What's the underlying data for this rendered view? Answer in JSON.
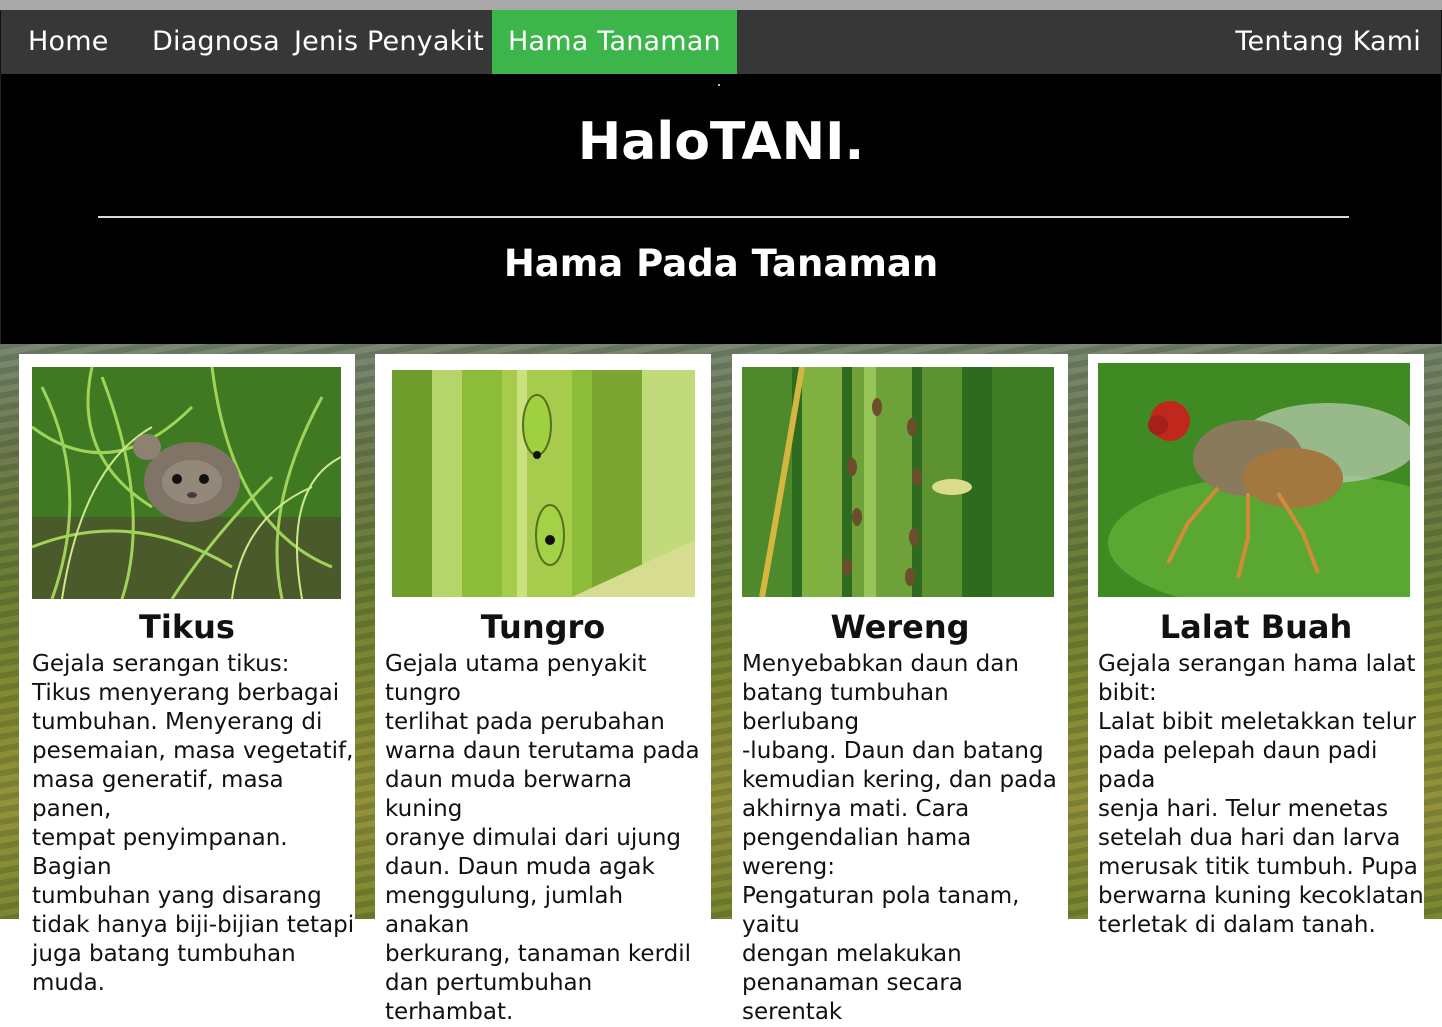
{
  "nav": {
    "items": [
      "Home",
      "Diagnosa",
      "Jenis Penyakit",
      "Hama Tanaman"
    ],
    "active": "Hama Tanaman",
    "right": "Tentang Kami"
  },
  "hero": {
    "title": "HaloTANI.",
    "subtitle": "Hama Pada Tanaman"
  },
  "cards": [
    {
      "title": "Tikus",
      "image_icon": "mouse-in-grass-photo",
      "text": "Gejala serangan tikus:\nTikus menyerang berbagai\ntumbuhan. Menyerang di\npesemaian, masa vegetatif,\nmasa generatif, masa panen,\ntempat penyimpanan. Bagian\ntumbuhan yang disarang\ntidak hanya biji-bijian tetapi\njuga batang tumbuhan muda."
    },
    {
      "title": "Tungro",
      "image_icon": "leafhopper-on-stem-photo",
      "text": "Gejala utama penyakit tungro\nterlihat pada perubahan\nwarna daun terutama pada\ndaun muda berwarna kuning\noranye dimulai dari ujung\ndaun. Daun muda agak\nmenggulung, jumlah anakan\nberkurang, tanaman kerdil\ndan pertumbuhan terhambat."
    },
    {
      "title": "Wereng",
      "image_icon": "planthopper-on-stem-photo",
      "text": "Menyebabkan daun dan\nbatang tumbuhan berlubang\n-lubang. Daun dan batang\nkemudian kering, dan pada\nakhirnya mati. Cara\npengendalian hama wereng:\nPengaturan pola tanam, yaitu\ndengan melakukan\npenanaman secara serentak"
    },
    {
      "title": "Lalat Buah",
      "image_icon": "fly-on-leaf-photo",
      "text": "Gejala serangan hama lalat\nbibit:\nLalat bibit meletakkan telur\npada pelepah daun padi pada\nsenja hari. Telur menetas\nsetelah dua hari dan larva\nmerusak titik tumbuh. Pupa\nberwarna kuning kecoklatan\nterletak di dalam tanah."
    }
  ],
  "colors": {
    "navbar": "#373737",
    "active_tab": "#3cb54a",
    "hero_bg": "#010101"
  }
}
